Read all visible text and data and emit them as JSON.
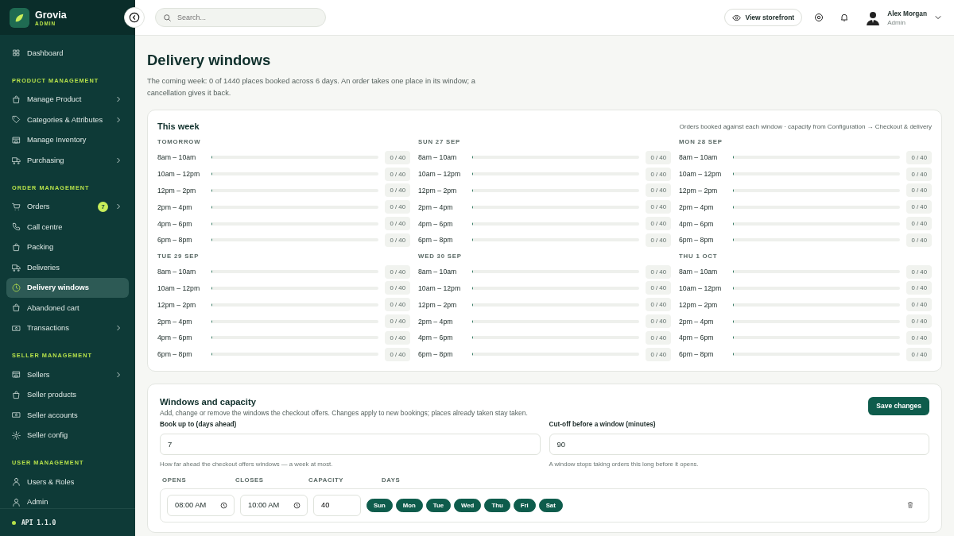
{
  "brand": {
    "name": "Grovia",
    "tag": "ADMIN"
  },
  "sidebar": {
    "sections": [
      {
        "items": [
          {
            "label": "Dashboard",
            "selected": false,
            "submenu": false
          }
        ]
      },
      {
        "heading": "PRODUCT MANAGEMENT",
        "items": [
          {
            "label": "Manage Product",
            "selected": false,
            "submenu": true
          },
          {
            "label": "Categories & Attributes",
            "selected": false,
            "submenu": true
          },
          {
            "label": "Manage Inventory",
            "selected": false,
            "submenu": false
          },
          {
            "label": "Purchasing",
            "selected": false,
            "submenu": true
          }
        ]
      },
      {
        "heading": "ORDER MANAGEMENT",
        "items": [
          {
            "label": "Orders",
            "selected": false,
            "submenu": true,
            "badge": "7"
          },
          {
            "label": "Call centre",
            "selected": false,
            "submenu": false
          },
          {
            "label": "Packing",
            "selected": false,
            "submenu": false
          },
          {
            "label": "Deliveries",
            "selected": false,
            "submenu": false
          },
          {
            "label": "Delivery windows",
            "selected": true,
            "submenu": false
          },
          {
            "label": "Abandoned cart",
            "selected": false,
            "submenu": false
          },
          {
            "label": "Transactions",
            "selected": false,
            "submenu": true
          }
        ]
      },
      {
        "heading": "SELLER MANAGEMENT",
        "items": [
          {
            "label": "Sellers",
            "selected": false,
            "submenu": true
          },
          {
            "label": "Seller products",
            "selected": false,
            "submenu": false
          },
          {
            "label": "Seller accounts",
            "selected": false,
            "submenu": false
          },
          {
            "label": "Seller config",
            "selected": false,
            "submenu": false
          }
        ]
      },
      {
        "heading": "USER MANAGEMENT",
        "items": [
          {
            "label": "Users & Roles",
            "selected": false,
            "submenu": false
          },
          {
            "label": "Admin",
            "selected": false,
            "submenu": false
          }
        ]
      }
    ],
    "footer": "API 1.1.0"
  },
  "header": {
    "search": {
      "placeholder": "Search..."
    },
    "storefront": "View storefront",
    "user": {
      "name": "Alex Morgan",
      "role": "Admin"
    }
  },
  "page": {
    "title": "Delivery windows",
    "intro": "The coming week: 0 of 1440 places booked across 6 days. An order takes one place in its window; a cancellation gives it back."
  },
  "week": {
    "title": "This week",
    "note": "Orders booked against each window · capacity from Configuration → Checkout & delivery",
    "days": [
      {
        "label": "TOMORROW",
        "slots": [
          {
            "time": "8am – 10am",
            "level": 0,
            "reading": "0 / 40"
          },
          {
            "time": "10am – 12pm",
            "level": 0,
            "reading": "0 / 40"
          },
          {
            "time": "12pm – 2pm",
            "level": 0,
            "reading": "0 / 40"
          },
          {
            "time": "2pm – 4pm",
            "level": 0,
            "reading": "0 / 40"
          },
          {
            "time": "4pm – 6pm",
            "level": 0,
            "reading": "0 / 40"
          },
          {
            "time": "6pm – 8pm",
            "level": 0,
            "reading": "0 / 40"
          }
        ]
      },
      {
        "label": "SUN 27 SEP",
        "slots": [
          {
            "time": "8am – 10am",
            "level": 0,
            "reading": "0 / 40"
          },
          {
            "time": "10am – 12pm",
            "level": 0,
            "reading": "0 / 40"
          },
          {
            "time": "12pm – 2pm",
            "level": 0,
            "reading": "0 / 40"
          },
          {
            "time": "2pm – 4pm",
            "level": 0,
            "reading": "0 / 40"
          },
          {
            "time": "4pm – 6pm",
            "level": 0,
            "reading": "0 / 40"
          },
          {
            "time": "6pm – 8pm",
            "level": 0,
            "reading": "0 / 40"
          }
        ]
      },
      {
        "label": "MON 28 SEP",
        "slots": [
          {
            "time": "8am – 10am",
            "level": 0,
            "reading": "0 / 40"
          },
          {
            "time": "10am – 12pm",
            "level": 0,
            "reading": "0 / 40"
          },
          {
            "time": "12pm – 2pm",
            "level": 0,
            "reading": "0 / 40"
          },
          {
            "time": "2pm – 4pm",
            "level": 0,
            "reading": "0 / 40"
          },
          {
            "time": "4pm – 6pm",
            "level": 0,
            "reading": "0 / 40"
          },
          {
            "time": "6pm – 8pm",
            "level": 0,
            "reading": "0 / 40"
          }
        ]
      },
      {
        "label": "TUE 29 SEP",
        "slots": [
          {
            "time": "8am – 10am",
            "level": 0,
            "reading": "0 / 40"
          },
          {
            "time": "10am – 12pm",
            "level": 0,
            "reading": "0 / 40"
          },
          {
            "time": "12pm – 2pm",
            "level": 0,
            "reading": "0 / 40"
          },
          {
            "time": "2pm – 4pm",
            "level": 0,
            "reading": "0 / 40"
          },
          {
            "time": "4pm – 6pm",
            "level": 0,
            "reading": "0 / 40"
          },
          {
            "time": "6pm – 8pm",
            "level": 0,
            "reading": "0 / 40"
          }
        ]
      },
      {
        "label": "WED 30 SEP",
        "slots": [
          {
            "time": "8am – 10am",
            "level": 0,
            "reading": "0 / 40"
          },
          {
            "time": "10am – 12pm",
            "level": 0,
            "reading": "0 / 40"
          },
          {
            "time": "12pm – 2pm",
            "level": 0,
            "reading": "0 / 40"
          },
          {
            "time": "2pm – 4pm",
            "level": 0,
            "reading": "0 / 40"
          },
          {
            "time": "4pm – 6pm",
            "level": 0,
            "reading": "0 / 40"
          },
          {
            "time": "6pm – 8pm",
            "level": 0,
            "reading": "0 / 40"
          }
        ]
      },
      {
        "label": "THU 1 OCT",
        "slots": [
          {
            "time": "8am – 10am",
            "level": 0,
            "reading": "0 / 40"
          },
          {
            "time": "10am – 12pm",
            "level": 0,
            "reading": "0 / 40"
          },
          {
            "time": "12pm – 2pm",
            "level": 0,
            "reading": "0 / 40"
          },
          {
            "time": "2pm – 4pm",
            "level": 0,
            "reading": "0 / 40"
          },
          {
            "time": "4pm – 6pm",
            "level": 0,
            "reading": "0 / 40"
          },
          {
            "time": "6pm – 8pm",
            "level": 0,
            "reading": "0 / 40"
          }
        ]
      }
    ]
  },
  "capacity": {
    "title": "Windows and capacity",
    "description": "Add, change or remove the windows the checkout offers. Changes apply to new bookings; places already taken stay taken.",
    "save": "Save changes",
    "fields": [
      {
        "label": "Book up to (days ahead)",
        "value": "7",
        "hint": "How far ahead the checkout offers windows — a week at most."
      },
      {
        "label": "Cut-off before a window (minutes)",
        "value": "90",
        "hint": "A window stops taking orders this long before it opens."
      }
    ],
    "columns": [
      "OPENS",
      "CLOSES",
      "CAPACITY",
      "DAYS"
    ],
    "windows": [
      {
        "opens": "08:00 AM",
        "closes": "10:00 AM",
        "capacity": "40",
        "days": [
          {
            "label": "Sun",
            "selected": true
          },
          {
            "label": "Mon",
            "selected": true
          },
          {
            "label": "Tue",
            "selected": true
          },
          {
            "label": "Wed",
            "selected": true
          },
          {
            "label": "Thu",
            "selected": true
          },
          {
            "label": "Fri",
            "selected": true
          },
          {
            "label": "Sat",
            "selected": true
          }
        ]
      }
    ]
  }
}
